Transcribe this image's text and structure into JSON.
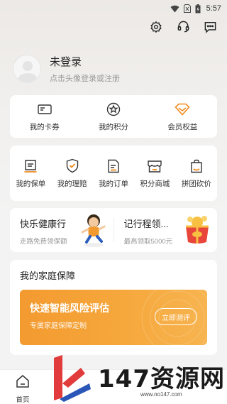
{
  "status_bar": {
    "time": "5:57"
  },
  "header": {
    "icons": [
      "gear-icon",
      "headset-icon",
      "message-icon"
    ]
  },
  "profile": {
    "title": "未登录",
    "subtitle": "点击头像登录或注册"
  },
  "quick_links": [
    {
      "label": "我的卡券",
      "icon": "card-icon"
    },
    {
      "label": "我的积分",
      "icon": "star-coin-icon"
    },
    {
      "label": "会员权益",
      "icon": "diamond-icon"
    }
  ],
  "services": [
    {
      "label": "我的保单",
      "icon": "policy-icon"
    },
    {
      "label": "我的理赔",
      "icon": "shield-check-icon"
    },
    {
      "label": "我的订单",
      "icon": "order-icon"
    },
    {
      "label": "积分商城",
      "icon": "store-icon"
    },
    {
      "label": "拼团砍价",
      "icon": "shopping-bag-icon"
    }
  ],
  "promos": [
    {
      "title": "快乐健康行",
      "subtitle": "走路免费领保额"
    },
    {
      "title": "记行程领...",
      "subtitle": "最高领取5000元"
    }
  ],
  "family": {
    "section_title": "我的家庭保障",
    "banner_title": "快速智能风险评估",
    "banner_subtitle": "专属家庭保障定制",
    "banner_button": "立即测评"
  },
  "tabbar": {
    "home_label": "首页"
  },
  "watermark": {
    "text": "147资源网",
    "url": "www.no147.com"
  },
  "colors": {
    "accent": "#f39a2f",
    "banner_start": "#f39a2f",
    "banner_end": "#f7b450",
    "diamond": "#f08a1c"
  }
}
